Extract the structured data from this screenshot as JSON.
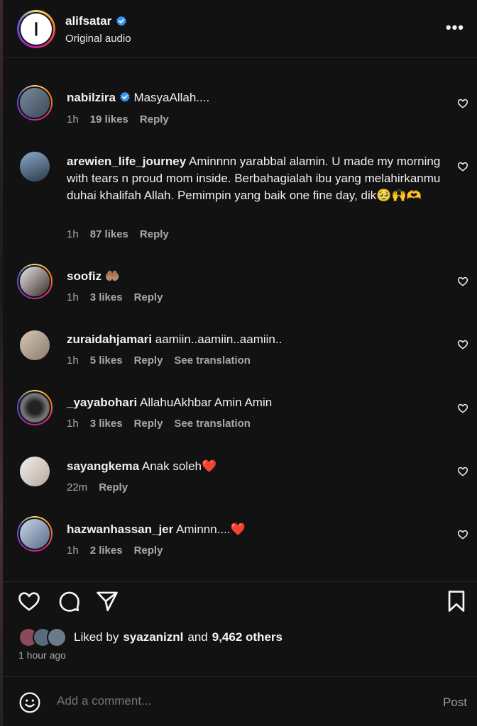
{
  "post": {
    "owner": "alifsatar",
    "owner_avatar_letter": "ا",
    "subtitle": "Original audio",
    "more": "•••"
  },
  "comments": [
    {
      "user": "nabilzira",
      "verified": true,
      "text": "MasyaAllah....",
      "time": "1h",
      "likes": "19 likes",
      "reply": "Reply",
      "translate": ""
    },
    {
      "user": "arewien_life_journey",
      "verified": false,
      "text": "Aminnnn yarabbal alamin. U made my morning with tears n proud mom inside. Berbahagialah ibu yang melahirkanmu duhai khalifah Allah. Pemimpin yang baik one fine day, dik🥹🙌🫶",
      "time": "1h",
      "likes": "87 likes",
      "reply": "Reply",
      "translate": ""
    },
    {
      "user": "soofiz",
      "verified": false,
      "text": "🤲🏽",
      "time": "1h",
      "likes": "3 likes",
      "reply": "Reply",
      "translate": ""
    },
    {
      "user": "zuraidahjamari",
      "verified": false,
      "text": "aamiin..aamiin..aamiin..",
      "time": "1h",
      "likes": "5 likes",
      "reply": "Reply",
      "translate": "See translation"
    },
    {
      "user": "_yayabohari",
      "verified": false,
      "text": "AllahuAkhbar Amin Amin",
      "time": "1h",
      "likes": "3 likes",
      "reply": "Reply",
      "translate": "See translation"
    },
    {
      "user": "sayangkema",
      "verified": false,
      "text": "Anak soleh❤️",
      "time": "22m",
      "likes": "",
      "reply": "Reply",
      "translate": ""
    },
    {
      "user": "hazwanhassan_jer",
      "verified": false,
      "text": "Aminnn....❤️",
      "time": "1h",
      "likes": "2 likes",
      "reply": "Reply",
      "translate": ""
    }
  ],
  "likes_summary": {
    "prefix": "Liked by",
    "user": "syazaniznl",
    "middle": "and",
    "others": "9,462 others"
  },
  "time_ago": "1 hour ago",
  "composer": {
    "placeholder": "Add a comment...",
    "post_label": "Post"
  },
  "icons": {
    "like": "heart-icon",
    "comment": "comment-icon",
    "share": "send-icon",
    "save": "bookmark-icon",
    "emoji": "emoji-icon"
  },
  "colors": {
    "background": "#121212",
    "text": "#f5f5f5",
    "muted": "#a8a8a8",
    "verified": "#3897f0"
  }
}
